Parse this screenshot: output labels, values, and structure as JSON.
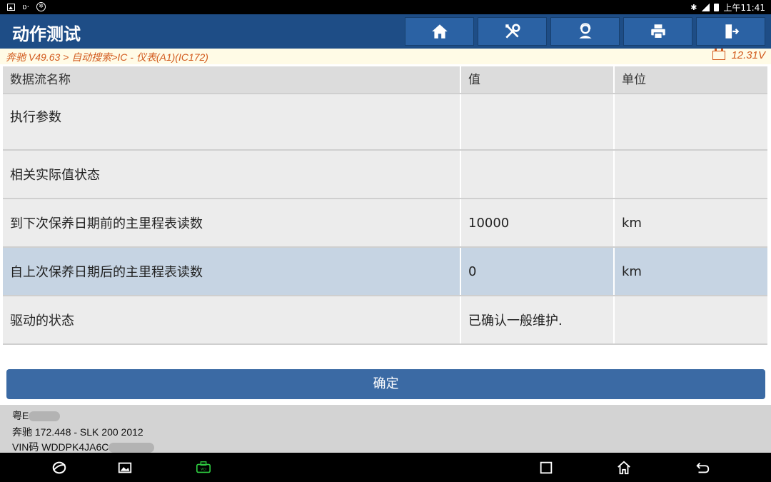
{
  "status_bar": {
    "left_icons": [
      "image-icon",
      "voicemail-icon",
      "app-circle-icon"
    ],
    "right_icons": [
      "bluetooth-icon",
      "signal-icon",
      "battery-icon"
    ],
    "time": "上午11:41"
  },
  "header": {
    "title": "动作测试",
    "toolbar": [
      {
        "icon": "home-icon"
      },
      {
        "icon": "tools-icon"
      },
      {
        "icon": "user-support-icon"
      },
      {
        "icon": "print-icon"
      },
      {
        "icon": "exit-icon"
      }
    ],
    "colors": {
      "bar": "#1e4d86",
      "button": "#2b62a4"
    }
  },
  "breadcrumb": {
    "path": "奔驰 V49.63 > 自动搜索>IC - 仪表(A1)(IC172)",
    "voltage": "12.31V",
    "color": "#d2591c"
  },
  "table": {
    "headers": {
      "name": "数据流名称",
      "value": "值",
      "unit": "单位"
    },
    "rows": [
      {
        "name": "执行参数",
        "value": "",
        "unit": ""
      },
      {
        "name": "相关实际值状态",
        "value": "",
        "unit": ""
      },
      {
        "name": "到下次保养日期前的主里程表读数",
        "value": "10000",
        "unit": "km"
      },
      {
        "name": "自上次保养日期后的主里程表读数",
        "value": "0",
        "unit": "km"
      },
      {
        "name": "驱动的状态",
        "value": "已确认一般维护.",
        "unit": ""
      }
    ],
    "selected_row": 3
  },
  "confirm_button": {
    "label": "确定"
  },
  "vehicle_info": {
    "plate": "粤E",
    "model": "奔驰 172.448 - SLK 200 2012",
    "vin": "VIN码 WDDPK4JA6C"
  },
  "nav_bar": {
    "items": [
      "browser-icon",
      "gallery-icon",
      "vci-icon",
      "recents-icon",
      "home-icon",
      "back-icon"
    ],
    "vci_color": "#2ecc40"
  }
}
